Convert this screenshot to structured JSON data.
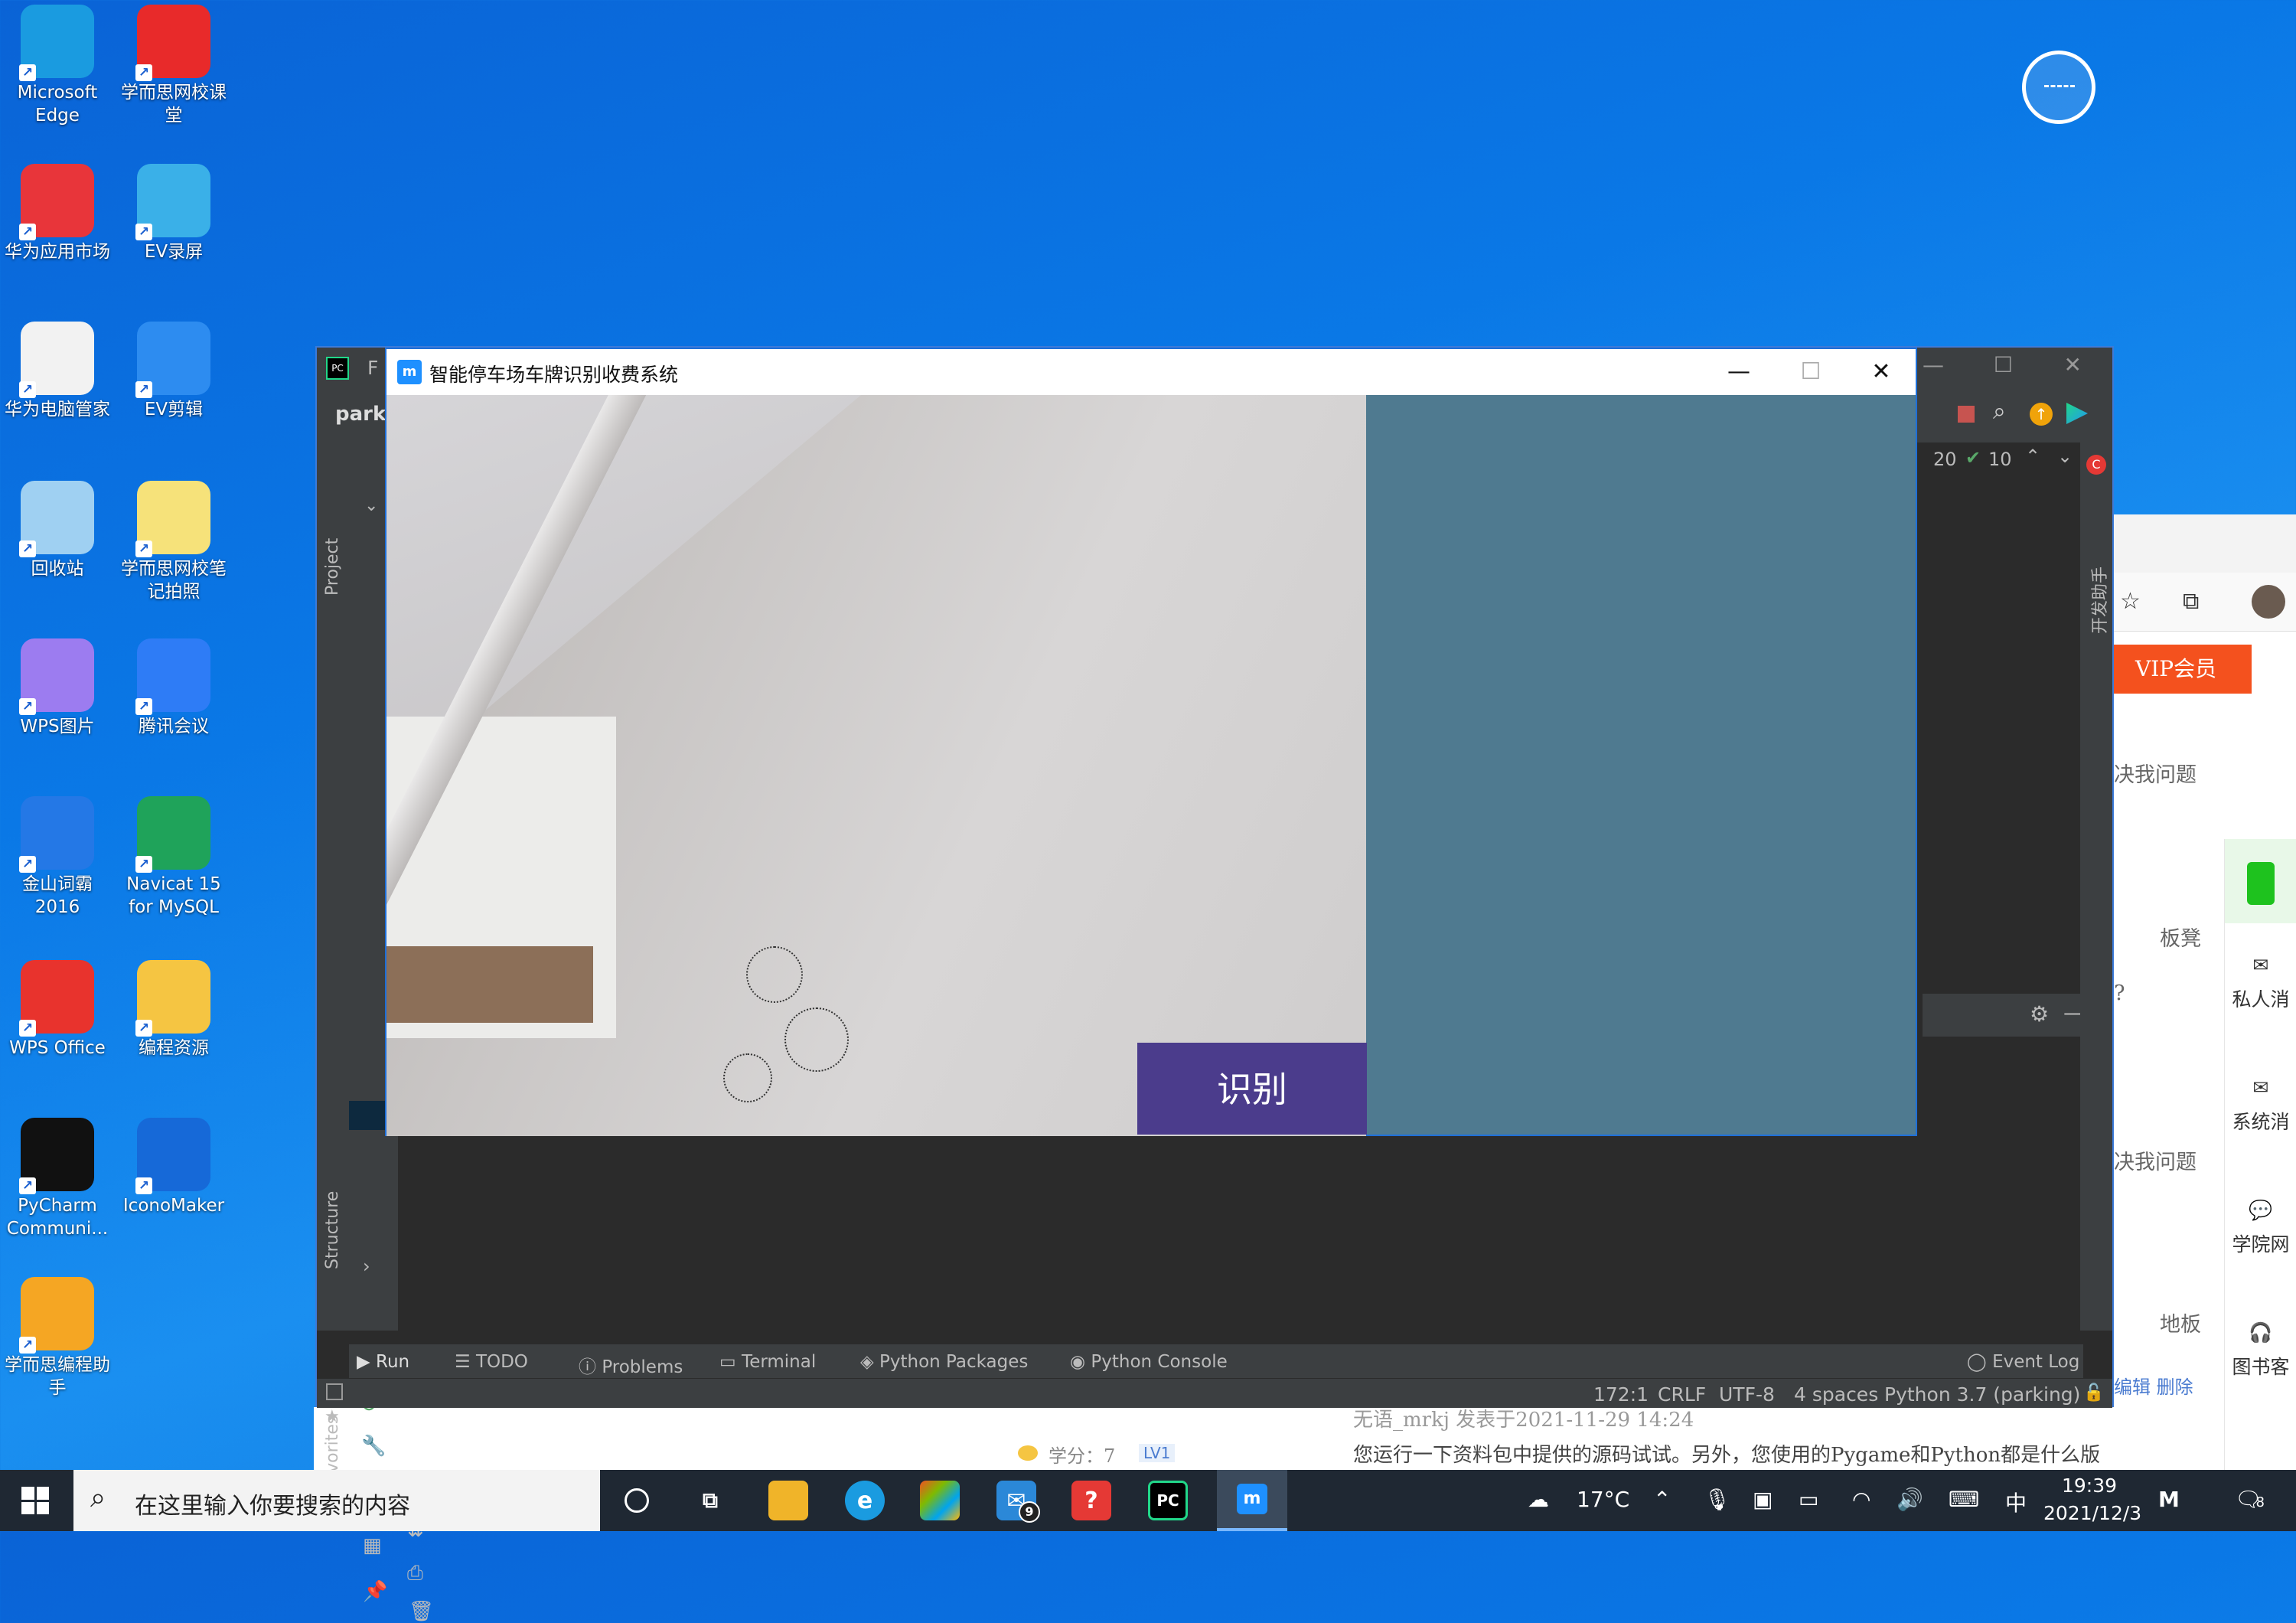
{
  "desktop": {
    "icons": [
      {
        "label": "Microsoft Edge",
        "icon": "edge-icon",
        "color": "#1a9be0"
      },
      {
        "label": "学而思网校课堂",
        "icon": "xueersi-icon",
        "color": "#e82a2a"
      },
      {
        "label": "华为应用市场",
        "icon": "huawei-appgallery-icon",
        "color": "#e8353a"
      },
      {
        "label": "EV录屏",
        "icon": "ev-recorder-icon",
        "color": "#3ab0e8"
      },
      {
        "label": "华为电脑管家",
        "icon": "huawei-pc-manager-icon",
        "color": "#f2f2f2"
      },
      {
        "label": "EV剪辑",
        "icon": "ev-editor-icon",
        "color": "#2d8cf0"
      },
      {
        "label": "回收站",
        "icon": "recycle-bin-icon",
        "color": "#9fd0f2"
      },
      {
        "label": "学而思网校笔记拍照",
        "icon": "note-file-icon",
        "color": "#f6e27a"
      },
      {
        "label": "WPS图片",
        "icon": "wps-picture-icon",
        "color": "#9c7cf0"
      },
      {
        "label": "腾讯会议",
        "icon": "tencent-meeting-icon",
        "color": "#2e7cf6"
      },
      {
        "label": "金山词霸 2016",
        "icon": "kingsoft-dict-icon",
        "color": "#2478e6"
      },
      {
        "label": "Navicat 15 for MySQL",
        "icon": "navicat-icon",
        "color": "#1fa35a"
      },
      {
        "label": "WPS Office",
        "icon": "wps-office-icon",
        "color": "#e8332d"
      },
      {
        "label": "编程资源",
        "icon": "folder-icon",
        "color": "#f5c542"
      },
      {
        "label": "PyCharm Communi...",
        "icon": "pycharm-icon",
        "color": "#111111"
      },
      {
        "label": "IconoMaker",
        "icon": "iconomaker-icon",
        "color": "#1669d8"
      },
      {
        "label": "学而思编程助手",
        "icon": "xueersi-coding-assistant-icon",
        "color": "#f5a623"
      }
    ]
  },
  "browser": {
    "vip": "VIP会员",
    "lines": [
      "决我问题",
      "板凳",
      "?",
      "决我问题",
      "地板",
      "编辑  删除"
    ],
    "side": [
      "私人消",
      "系统消",
      "学院网",
      "图书客"
    ],
    "comment_author": "无语_mrkj 发表于2021-11-29 14:24",
    "comment_body": "您运行一下资料包中提供的源码试试。另外，您使用的Pygame和Python都是什么版本?",
    "score_label": "学分：7",
    "level": "LV1"
  },
  "ide": {
    "title_initial": "F",
    "project_name": "parki",
    "inspections": {
      "warnings": "20",
      "ok": "10"
    },
    "side_tabs": {
      "project": "Project",
      "structure": "Structure",
      "favorites": "Favorites",
      "assistant": "开发助手"
    },
    "run_label": "Ru",
    "toolbar": [
      "Run",
      "TODO",
      "Problems",
      "Terminal",
      "Python Packages",
      "Python Console"
    ],
    "event_log": "Event Log",
    "status": {
      "position": "172:1",
      "line_sep": "CRLF",
      "encoding": "UTF-8",
      "indent": "4 spaces",
      "interpreter": "Python 3.7 (parking)"
    }
  },
  "app": {
    "title": "智能停车场车牌识别收费系统",
    "logo": "m",
    "minimize": "—",
    "maximize": "☐",
    "close": "✕",
    "recognize_button": "识别"
  },
  "taskbar": {
    "search_placeholder": "在这里输入你要搜索的内容",
    "mail_badge": "9",
    "weather": "17°C",
    "ime": "中",
    "time": "19:39",
    "date": "2021/12/3",
    "notifications": "8"
  }
}
